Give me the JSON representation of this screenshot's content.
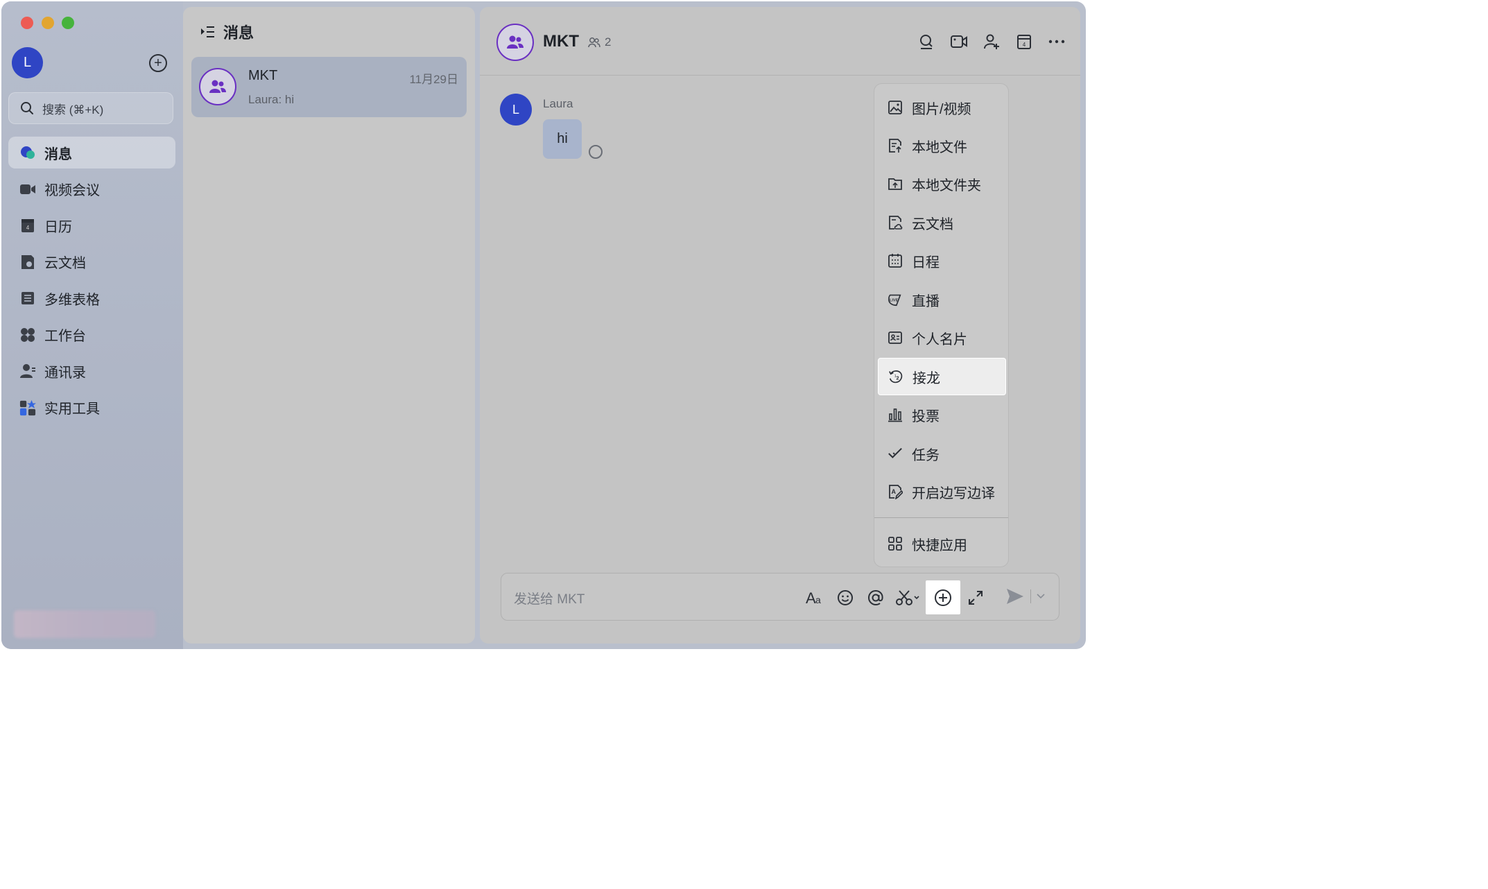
{
  "sidebar": {
    "avatar_letter": "L",
    "search_placeholder": "搜索 (⌘+K)",
    "nav": [
      {
        "label": "消息",
        "icon": "message-bubble-icon",
        "active": true
      },
      {
        "label": "视频会议",
        "icon": "video-camera-icon"
      },
      {
        "label": "日历",
        "icon": "calendar-icon"
      },
      {
        "label": "云文档",
        "icon": "cloud-doc-icon"
      },
      {
        "label": "多维表格",
        "icon": "table-grid-icon"
      },
      {
        "label": "工作台",
        "icon": "workspace-grid-icon"
      },
      {
        "label": "通讯录",
        "icon": "contacts-icon"
      },
      {
        "label": "实用工具",
        "icon": "tools-icon"
      }
    ]
  },
  "chat_list": {
    "title": "消息",
    "items": [
      {
        "name": "MKT",
        "date": "11月29日",
        "preview": "Laura: hi"
      }
    ]
  },
  "chat": {
    "title": "MKT",
    "member_count": "2",
    "messages": [
      {
        "sender": "Laura",
        "avatar_letter": "L",
        "text": "hi"
      }
    ],
    "composer_placeholder": "发送给 MKT"
  },
  "plus_menu": {
    "items": [
      {
        "label": "图片/视频",
        "icon": "image-icon"
      },
      {
        "label": "本地文件",
        "icon": "upload-file-icon"
      },
      {
        "label": "本地文件夹",
        "icon": "upload-folder-icon"
      },
      {
        "label": "云文档",
        "icon": "cloud-doc-icon"
      },
      {
        "label": "日程",
        "icon": "schedule-icon"
      },
      {
        "label": "直播",
        "icon": "live-icon"
      },
      {
        "label": "个人名片",
        "icon": "contact-card-icon"
      },
      {
        "label": "接龙",
        "icon": "relay-icon",
        "highlighted": true
      },
      {
        "label": "投票",
        "icon": "poll-icon"
      },
      {
        "label": "任务",
        "icon": "task-check-icon"
      },
      {
        "label": "开启边写边译",
        "icon": "translate-icon"
      }
    ],
    "footer": {
      "label": "快捷应用",
      "icon": "quick-apps-icon"
    }
  },
  "colors": {
    "avatar_blue": "#2f45c4",
    "group_avatar_ring": "#6a30c2",
    "highlight": "#ffffff"
  }
}
